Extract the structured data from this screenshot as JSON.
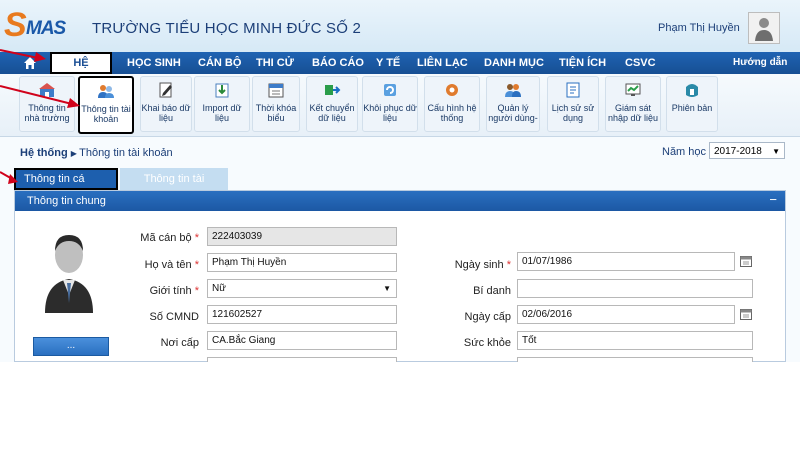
{
  "header": {
    "logo_text": "SMAS",
    "school_name": "TRƯỜNG TIỂU HỌC MINH ĐỨC SỐ 2",
    "user_name": "Phạm Thị Huyền"
  },
  "nav": {
    "items": [
      "HỆ THỐNG",
      "HỌC SINH",
      "CÁN BỘ",
      "THI CỬ",
      "BÁO CÁO",
      "Y TẾ",
      "LIÊN LẠC",
      "DANH MỤC",
      "TIỆN ÍCH",
      "CSVC"
    ],
    "help": "Hướng dẫn",
    "active": "HỆ THỐNG"
  },
  "toolbar": {
    "items": [
      "Thông tin nhà trường",
      "Thông tin tài khoản",
      "Khai báo dữ liệu",
      "Import dữ liệu",
      "Thời khóa biểu",
      "Kết chuyển dữ liệu",
      "Khôi phục dữ liệu",
      "Cấu hình hệ thống",
      "Quản lý người dùng-",
      "Lịch sử sử dụng",
      "Giám sát nhập dữ liệu",
      "Phiên bản"
    ],
    "selected": "Thông tin tài khoản"
  },
  "breadcrumb": {
    "root": "Hệ thống",
    "current": "Thông tin tài khoản"
  },
  "year": {
    "label": "Năm học",
    "value": "2017-2018"
  },
  "tabs": {
    "personal": "Thông tin cá nhân",
    "account": "Thông tin tài khoản"
  },
  "panel": {
    "title": "Thông tin chung",
    "collapse": "−",
    "photo_button": "...",
    "fields": {
      "staff_code": {
        "label": "Mã cán bộ",
        "value": "222403039"
      },
      "full_name": {
        "label": "Họ và tên",
        "value": "Phạm Thị Huyền"
      },
      "gender": {
        "label": "Giới tính",
        "value": "Nữ"
      },
      "id_number": {
        "label": "Số CMND",
        "value": "121602527"
      },
      "issue_place": {
        "label": "Nơi cấp",
        "value": "CA.Bắc Giang"
      },
      "birth_date": {
        "label": "Ngày sinh",
        "value": "01/07/1986"
      },
      "alias": {
        "label": "Bí danh",
        "value": ""
      },
      "issue_date": {
        "label": "Ngày cấp",
        "value": "02/06/2016"
      },
      "health": {
        "label": "Sức khỏe",
        "value": "Tốt"
      }
    }
  },
  "colors": {
    "nav": "#1f63b3",
    "accent_orange": "#e87a1e",
    "annotation_red": "#d0021b"
  }
}
